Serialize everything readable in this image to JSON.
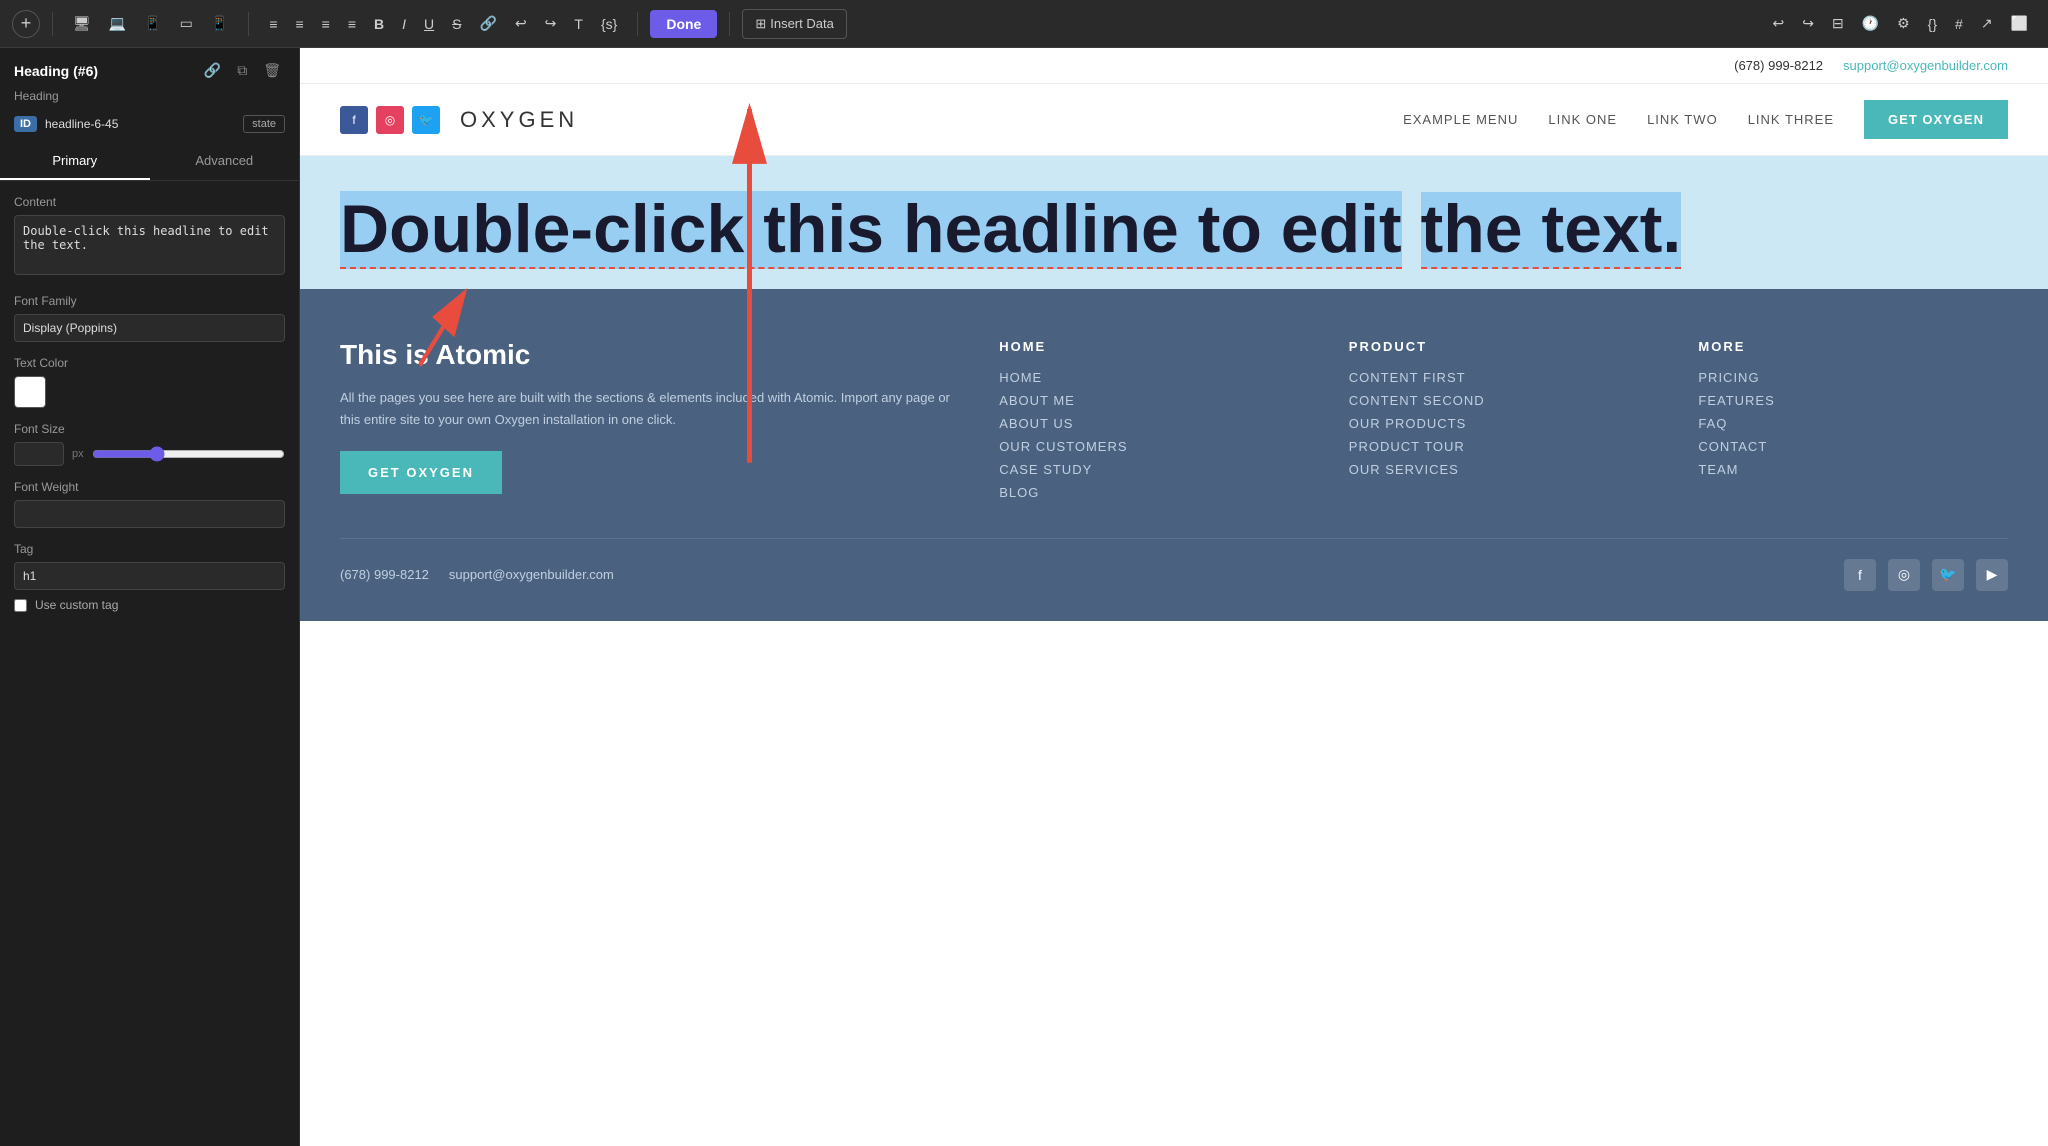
{
  "toolbar": {
    "add_label": "+",
    "done_label": "Done",
    "insert_data_label": "Insert Data",
    "format_buttons": [
      "≡",
      "≡",
      "≡",
      "≡",
      "B",
      "I",
      "U",
      "S",
      "🔗",
      "↩",
      "↪",
      "T",
      "{s}"
    ]
  },
  "left_panel": {
    "title": "Heading (#6)",
    "subtitle": "Heading",
    "id_label": "ID",
    "id_value": "headline-6-45",
    "state_label": "state",
    "tabs": [
      "Primary",
      "Advanced"
    ],
    "active_tab": "Primary",
    "content_label": "Content",
    "content_value": "Double-click this headline to edit the text.",
    "font_family_label": "Font Family",
    "font_family_value": "Display (Poppins)",
    "text_color_label": "Text Color",
    "font_size_label": "Font Size",
    "font_size_px": "px",
    "font_weight_label": "Font Weight",
    "tag_label": "Tag",
    "tag_value": "h1",
    "custom_tag_label": "Use custom tag"
  },
  "site": {
    "topbar": {
      "phone": "(678) 999-8212",
      "email": "support@oxygenbuilder.com"
    },
    "nav": {
      "logo": "OXYGEN",
      "links": [
        "EXAMPLE MENU",
        "LINK ONE",
        "LINK TWO",
        "LINK THREE"
      ],
      "cta": "GET OXYGEN"
    },
    "hero": {
      "heading_line1": "Double-click this headline to edit",
      "heading_line2": "the text."
    },
    "footer": {
      "brand_title": "This is Atomic",
      "brand_desc": "All the pages you see here are built with the sections & elements included with Atomic. Import any page or this entire site to your own Oxygen installation in one click.",
      "cta": "GET OXYGEN",
      "columns": [
        {
          "title": "HOME",
          "links": [
            "HOME",
            "ABOUT ME",
            "ABOUT US",
            "OUR CUSTOMERS",
            "CASE STUDY",
            "BLOG"
          ]
        },
        {
          "title": "PRODUCT",
          "links": [
            "CONTENT FIRST",
            "CONTENT SECOND",
            "OUR PRODUCTS",
            "PRODUCT TOUR",
            "OUR SERVICES"
          ]
        },
        {
          "title": "MORE",
          "links": [
            "PRICING",
            "FEATURES",
            "FAQ",
            "CONTACT",
            "TEAM"
          ]
        }
      ],
      "bottom_phone": "(678) 999-8212",
      "bottom_email": "support@oxygenbuilder.com",
      "social_icons": [
        "f",
        "📷",
        "🐦",
        "▶"
      ]
    }
  }
}
